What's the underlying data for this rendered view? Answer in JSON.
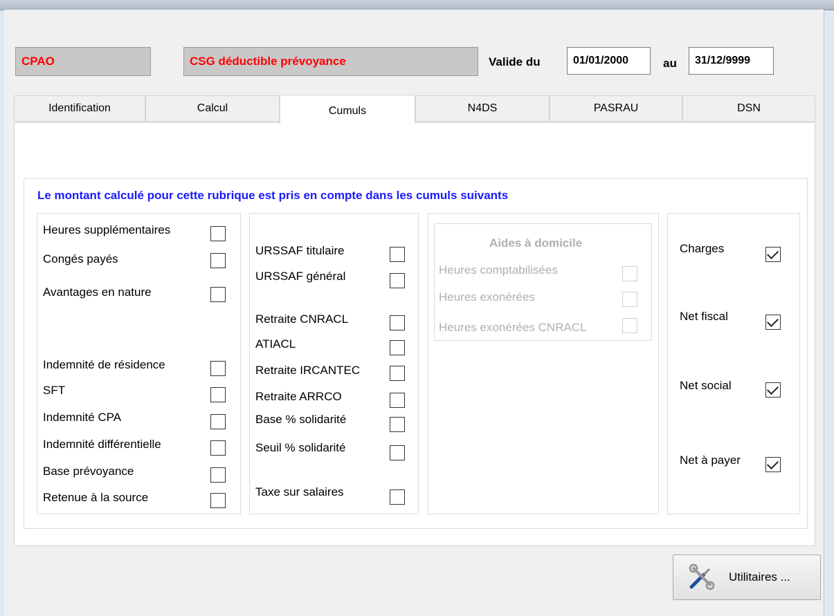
{
  "header": {
    "code": "CPAO",
    "label": "CSG déductible prévoyance",
    "valid_from_label": "Valide du",
    "valid_from": "01/01/2000",
    "to_label": "au",
    "valid_to": "31/12/9999"
  },
  "tabs": [
    "Identification",
    "Calcul",
    "Cumuls",
    "N4DS",
    "PASRAU",
    "DSN"
  ],
  "active_tab": "Cumuls",
  "cumuls": {
    "heading": "Le montant calculé pour cette rubrique est pris en compte dans les cumuls suivants",
    "heading_color": "#1a1aff",
    "col1": [
      {
        "label": "Heures supplémentaires",
        "checked": false
      },
      {
        "label": "Congés payés",
        "checked": false
      },
      {
        "label": "Avantages en nature",
        "checked": false
      },
      {
        "label": "Indemnité de résidence",
        "checked": false
      },
      {
        "label": "SFT",
        "checked": false
      },
      {
        "label": "Indemnité CPA",
        "checked": false
      },
      {
        "label": "Indemnité différentielle",
        "checked": false
      },
      {
        "label": "Base prévoyance",
        "checked": false
      },
      {
        "label": "Retenue à la source",
        "checked": false
      }
    ],
    "col2": [
      {
        "label": "URSSAF titulaire",
        "checked": false
      },
      {
        "label": "URSSAF général",
        "checked": false
      },
      {
        "label": "Retraite CNRACL",
        "checked": false
      },
      {
        "label": "ATIACL",
        "checked": false
      },
      {
        "label": "Retraite IRCANTEC",
        "checked": false
      },
      {
        "label": "Retraite ARRCO",
        "checked": false
      },
      {
        "label": "Base % solidarité",
        "checked": false
      },
      {
        "label": "Seuil % solidarité",
        "checked": false
      },
      {
        "label": "Taxe sur salaires",
        "checked": false
      }
    ],
    "aides": {
      "title": "Aides à domicile",
      "items": [
        {
          "label": "Heures comptabilisées",
          "checked": false
        },
        {
          "label": "Heures exonérées",
          "checked": false
        },
        {
          "label": "Heures exonérées CNRACL",
          "checked": false
        }
      ]
    },
    "col4": [
      {
        "label": "Charges",
        "checked": true
      },
      {
        "label": "Net fiscal",
        "checked": true
      },
      {
        "label": "Net social",
        "checked": true
      },
      {
        "label": "Net à payer",
        "checked": true
      }
    ]
  },
  "footer": {
    "utilities_label": "Utilitaires ...",
    "utilities_icon": "tools-icon"
  },
  "colors": {
    "code_text": "#ff0000",
    "heading": "#1a1aff",
    "disabled_text": "#b0b0b0"
  }
}
